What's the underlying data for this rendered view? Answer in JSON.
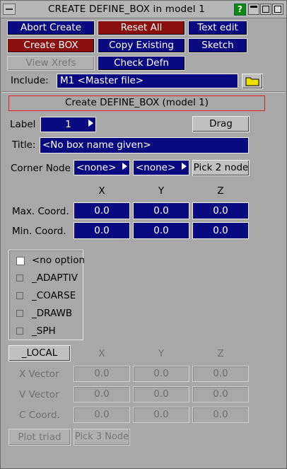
{
  "window": {
    "title": "CREATE DEFINE_BOX in model 1",
    "help_label": "?"
  },
  "toolbar": {
    "abort": "Abort Create",
    "reset": "Reset All",
    "text_edit": "Text edit",
    "create_box": "Create BOX",
    "copy_existing": "Copy Existing",
    "sketch": "Sketch",
    "view_xrefs": "View Xrefs",
    "check_defn": "Check Defn"
  },
  "include": {
    "label": "Include:",
    "value": "M1  <Master file>"
  },
  "section_title": "Create DEFINE_BOX (model 1)",
  "label_row": {
    "label": "Label",
    "value": "1",
    "drag": "Drag"
  },
  "title_row": {
    "label": "Title:",
    "value": "<No box name given>"
  },
  "corner": {
    "label": "Corner Node",
    "node1": "<none>",
    "node2": "<none>",
    "pick": "Pick 2 node"
  },
  "coords": {
    "headers": [
      "X",
      "Y",
      "Z"
    ],
    "max_label": "Max. Coord.",
    "min_label": "Min. Coord.",
    "max": [
      "0.0",
      "0.0",
      "0.0"
    ],
    "min": [
      "0.0",
      "0.0",
      "0.0"
    ]
  },
  "options": [
    "<no option",
    "_ADAPTIV",
    "_COARSE",
    "_DRAWB",
    "_SPH"
  ],
  "local": {
    "button": "_LOCAL",
    "headers": [
      "X",
      "Y",
      "Z"
    ],
    "rows": [
      {
        "label": "X Vector",
        "values": [
          "0.0",
          "0.0",
          "0.0"
        ]
      },
      {
        "label": "V Vector",
        "values": [
          "0.0",
          "0.0",
          "0.0"
        ]
      },
      {
        "label": "C Coord.",
        "values": [
          "0.0",
          "0.0",
          "0.0"
        ]
      }
    ],
    "plot_triad": "Plot triad",
    "pick_3_node": "Pick 3 Node"
  },
  "colors": {
    "panel": "#a8a8a8",
    "button_blue": "#0a0a80",
    "button_red": "#8a1010",
    "section_border": "#e02020",
    "help_green": "#108810"
  },
  "icons": {
    "folder": "folder-icon",
    "menu": "window-menu-icon"
  }
}
